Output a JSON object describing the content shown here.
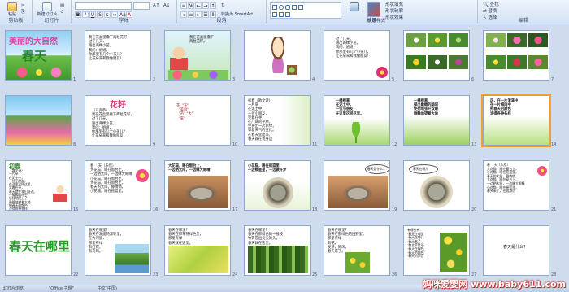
{
  "ribbon": {
    "groups": [
      {
        "label": "剪贴板",
        "buttons": [
          "粘贴"
        ]
      },
      {
        "label": "幻灯片",
        "buttons": [
          "新建幻灯片"
        ]
      },
      {
        "label": "字体",
        "font_name": "",
        "font_size": ""
      },
      {
        "label": "段落"
      },
      {
        "label": "绘图"
      },
      {
        "label": "编辑",
        "items": [
          "查找",
          "替换",
          "选择"
        ]
      }
    ],
    "extra_labels": [
      "快速样式",
      "形状填充",
      "形状轮廓",
      "形状效果",
      "转换为 SmartArt"
    ]
  },
  "slides": [
    {
      "n": "1",
      "title": "美丽的大自然",
      "big": "春天"
    },
    {
      "n": "2",
      "text": "我在花盆里撒下两粒花籽，\n过了几天，\n跑出两棵小苗。\n我问：姐姐，\n你那里有几个小孩儿？\n让花朵来和我做朋友！"
    },
    {
      "n": "3",
      "text": "我在花盆里撒下\n两粒花籽。"
    },
    {
      "n": "4",
      "text": ""
    },
    {
      "n": "5",
      "text": "过了几天，\n跑出两棵小苗。\n我问：姐姐，\n你那里有几个小孩儿，\n让花朵来和我做朋友！"
    },
    {
      "n": "6",
      "captions": [
        "",
        "",
        "",
        "",
        "",
        ""
      ]
    },
    {
      "n": "7",
      "captions": [
        "",
        "",
        "",
        "",
        "",
        ""
      ]
    },
    {
      "n": "8",
      "text": ""
    },
    {
      "n": "9",
      "title": "花籽",
      "text": "（马克恭）\n我在花盆里撒下两粒花籽，\n过了几天，\n跑出两棵小苗。\n我问：姐姐，\n你那里有几个小孩儿？\n让花朵来和我做朋友！"
    },
    {
      "n": "10",
      "text": "花  \"天\"\n  \"美丽\"\n  \"苗\" \"大\"\n  \"来\""
    },
    {
      "n": "11",
      "text": "初春（散文诗）\n一片草\n在泥土中，\n一位小朋友，\n笑着在寻，\n在广阔的平原，\n生长出一片新绿，\n等着天气的变化。\n在春天里出来，\n春天就在我身边"
    },
    {
      "n": "12",
      "text": "一棵棵草\n在泥土中，\n一位小朋友\n在这里这样这里。"
    },
    {
      "n": "13",
      "text": "一棵棵草\n探出嫩嫩的脑袋\n使劲地张开双眼\n静静地望着大地"
    },
    {
      "n": "14",
      "text": "风，在一片清溪中\n在一片细雨中\n把春天的颜色\n涂得各种各样"
    },
    {
      "n": "15",
      "title": "初春",
      "text": "（散文诗）\n一片草\n在泥土中，\n一位小朋友，\n在这里这样这里，\n笑着在寻，\n春天就在我们身边。\n一簇簇的叶子\n轻轻地爬上了\n静静地望着大地\n把春天的颜色\n涂得各种各样"
    },
    {
      "n": "16",
      "text": "春    天（乐然）\n大花猫，睡在窗台上，\n一边晒太阳，一边眯大眼睛\n小花猫，睡在窗台上，\n大花猫，睡在窗台上，\n春天的太阳，静悄悄，\n小花猫，睡在摇篮里。"
    },
    {
      "n": "17",
      "text": "大花猫，睡在窗台上，\n一边晒太阳，一边眯大眼睛"
    },
    {
      "n": "18",
      "text": "小花猫，睡在摇篮里，\n一边数星星，一边做好梦"
    },
    {
      "n": "19",
      "text": "春天是什么?"
    },
    {
      "n": "20",
      "text": "春天在哪儿"
    },
    {
      "n": "21",
      "text": "春    天（乐然）\n大花猫，睡在窗台上，\n小花猫，睡在摇篮里，\n春天的太阳，静悄悄，\n大花猫，睡在窗台上，\n一边晒太阳，一边眯大眼睛\n小花猫，睡在摇篮里，\n春天来了，在我身边"
    },
    {
      "n": "22",
      "big": "春天在哪里"
    },
    {
      "n": "23",
      "text": "春天在哪里？\n春天在湖面的渡轮里，\n在大河里，\n那里有绿\n有红花，\n有鸟鸣。"
    },
    {
      "n": "24",
      "text": "春天在哪里？\n春天在那草芽绿色里，\n那里有绿\n春天就在这里。"
    },
    {
      "n": "25",
      "text": "春天在哪里？\n春天在那绿色的一枝枝\n竹笋冒出尖尖的头，\n春天就在这里。"
    },
    {
      "n": "26",
      "text": "春天在哪里？\n春天在那绿色的田野里，\n那里有绿\n有花，\n发芽，随风，\n春天来了。"
    },
    {
      "n": "27",
      "text": "有哪些有：\n·春天在哪里\n·春天在哪儿\n·春天来了\n·春天是什么\n·春天在绿色\n·春天的颜色\n·春天的声音"
    },
    {
      "n": "28",
      "text": "春天是什么?"
    }
  ],
  "status": {
    "left": "幻灯片浏览",
    "theme": "\"Office 主题\"",
    "language": "中文(中国)"
  },
  "watermark": "妈咪爱婴网 www.baby611.com",
  "colors": {
    "background": "#cfdcee",
    "ribbon": "#d4e2f4",
    "selected": "#f0a030"
  }
}
